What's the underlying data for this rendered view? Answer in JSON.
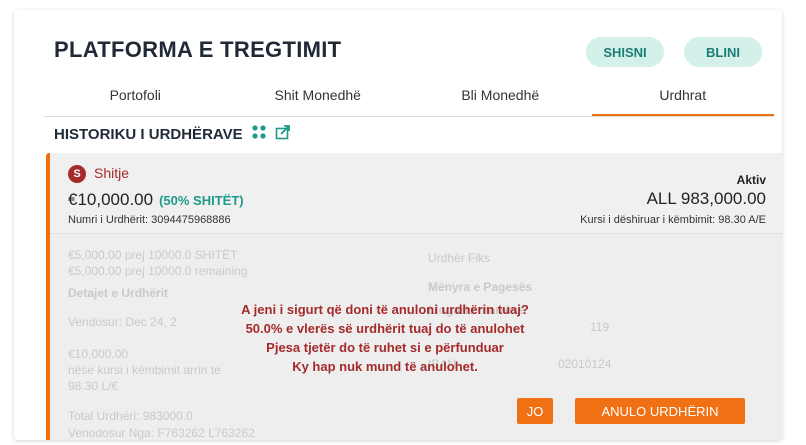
{
  "header": {
    "title": "PLATFORMA E TREGTIMIT",
    "sell_btn": "SHISNI",
    "buy_btn": "BLINI"
  },
  "tabs": [
    {
      "label": "Portofoli",
      "active": false
    },
    {
      "label": "Shit Monedhë",
      "active": false
    },
    {
      "label": "Bli Monedhë",
      "active": false
    },
    {
      "label": "Urdhrat",
      "active": true
    }
  ],
  "history": {
    "title": "HISTORIKU I URDHËRAVE"
  },
  "order": {
    "badge": "S",
    "type": "Shitje",
    "amount": "€10,000.00",
    "sold_pct": "(50% SHITËT)",
    "order_number": "Numri i Urdhërit: 3094475968886",
    "status": "Aktiv",
    "all_amount": "ALL 983,000.00",
    "rate": "Kursi i dëshiruar i këmbimit: 98.30 A/E",
    "details": {
      "l1": "€5,000.00 prej 10000.0 SHITËT",
      "l2": "€5,000.00 prej 10000.0 remaining",
      "l3": "Detajet e Urdhërit",
      "l4": "Vendosur: Dec 24, 2",
      "l5": "€10,000.00",
      "l6": "nëse kursi i këmbimit arrin te",
      "l7": "98.30 L/€",
      "l8": "Total Urdhëri: 983000.0",
      "l9": "Venodosur Nga: F763262 L763262",
      "r1": "Urdhër Fiks",
      "r2": "Mënyra e Pagesës",
      "r3": "Llogaria marrëse",
      "r4": "119",
      "r5": "IBAN",
      "r6": "02010124"
    }
  },
  "modal": {
    "line1": "A jeni i sigurt që doni të anuloni urdhërin tuaj?",
    "line2": "50.0% e vlerës së urdhërit tuaj do të anulohet",
    "line3": "Pjesa tjetër do të ruhet si e përfunduar",
    "line4": "Ky hap nuk mund të anulohet.",
    "no_btn": "JO",
    "cancel_btn": "ANULO URDHËRIN"
  },
  "colors": {
    "accent": "#f07014",
    "sell": "#a52a2a",
    "teal": "#1c7f73",
    "pill_bg": "#d3f0ea"
  }
}
